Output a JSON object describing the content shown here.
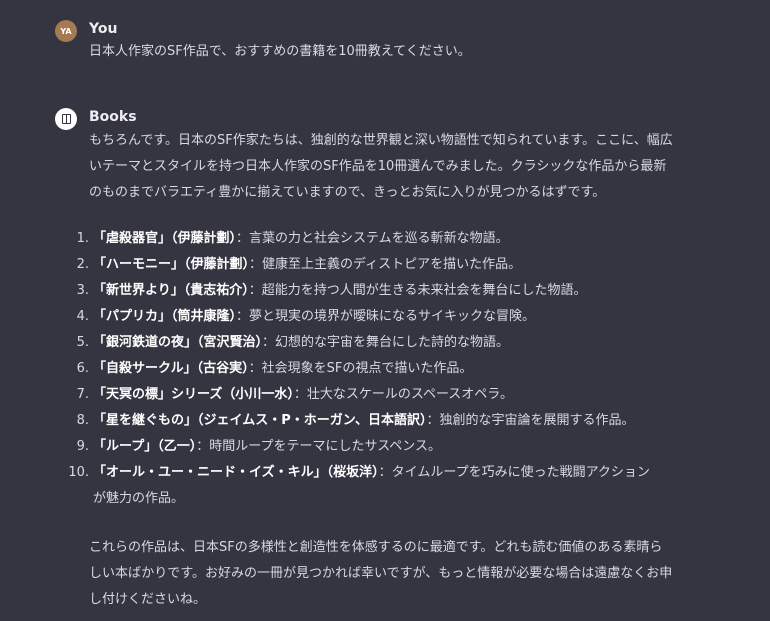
{
  "user_message": {
    "avatar_initials": "YA",
    "author": "You",
    "text": "日本人作家のSF作品で、おすすめの書籍を10冊教えてください。"
  },
  "bot_message": {
    "avatar_icon": "book-icon",
    "author": "Books",
    "intro": "もちろんです。日本のSF作家たちは、独創的な世界観と深い物語性で知られています。ここに、幅広いテーマとスタイルを持つ日本人作家のSF作品を10冊選んでみました。クラシックな作品から最新のものまでバラエティ豊かに揃えていますので、きっとお気に入りが見つかるはずです。",
    "books": [
      {
        "num": "1.",
        "title": "「虐殺器官」（伊藤計劃）",
        "desc": "：言葉の力と社会システムを巡る斬新な物語。"
      },
      {
        "num": "2.",
        "title": "「ハーモニー」（伊藤計劃）",
        "desc": "：健康至上主義のディストピアを描いた作品。"
      },
      {
        "num": "3.",
        "title": "「新世界より」（貴志祐介）",
        "desc": "：超能力を持つ人間が生きる未来社会を舞台にした物語。"
      },
      {
        "num": "4.",
        "title": "「パプリカ」（筒井康隆）",
        "desc": "：夢と現実の境界が曖昧になるサイキックな冒険。"
      },
      {
        "num": "5.",
        "title": "「銀河鉄道の夜」（宮沢賢治）",
        "desc": "：幻想的な宇宙を舞台にした詩的な物語。"
      },
      {
        "num": "6.",
        "title": "「自殺サークル」（古谷実）",
        "desc": "：社会現象をSFの視点で描いた作品。"
      },
      {
        "num": "7.",
        "title": "「天冥の標」シリーズ（小川一水）",
        "desc": "：壮大なスケールのスペースオペラ。"
      },
      {
        "num": "8.",
        "title": "「星を継ぐもの」（ジェイムス・P・ホーガン、日本語訳）",
        "desc": "：独創的な宇宙論を展開する作品。"
      },
      {
        "num": "9.",
        "title": "「ループ」（乙一）",
        "desc": "：時間ループをテーマにしたサスペンス。"
      },
      {
        "num": "10.",
        "title": "「オール・ユー・ニード・イズ・キル」（桜坂洋）",
        "desc": "：タイムループを巧みに使った戦闘アクションが魅力の作品。"
      }
    ],
    "conclusion": "これらの作品は、日本SFの多様性と創造性を体感するのに最適です。どれも読む価値のある素晴らしい本ばかりです。お好みの一冊が見つかれば幸いですが、もっと情報が必要な場合は遠慮なくお申し付けくださいね。"
  },
  "colors": {
    "background": "#343541",
    "text": "#d9d9e3",
    "user_avatar": "#a57a53"
  }
}
